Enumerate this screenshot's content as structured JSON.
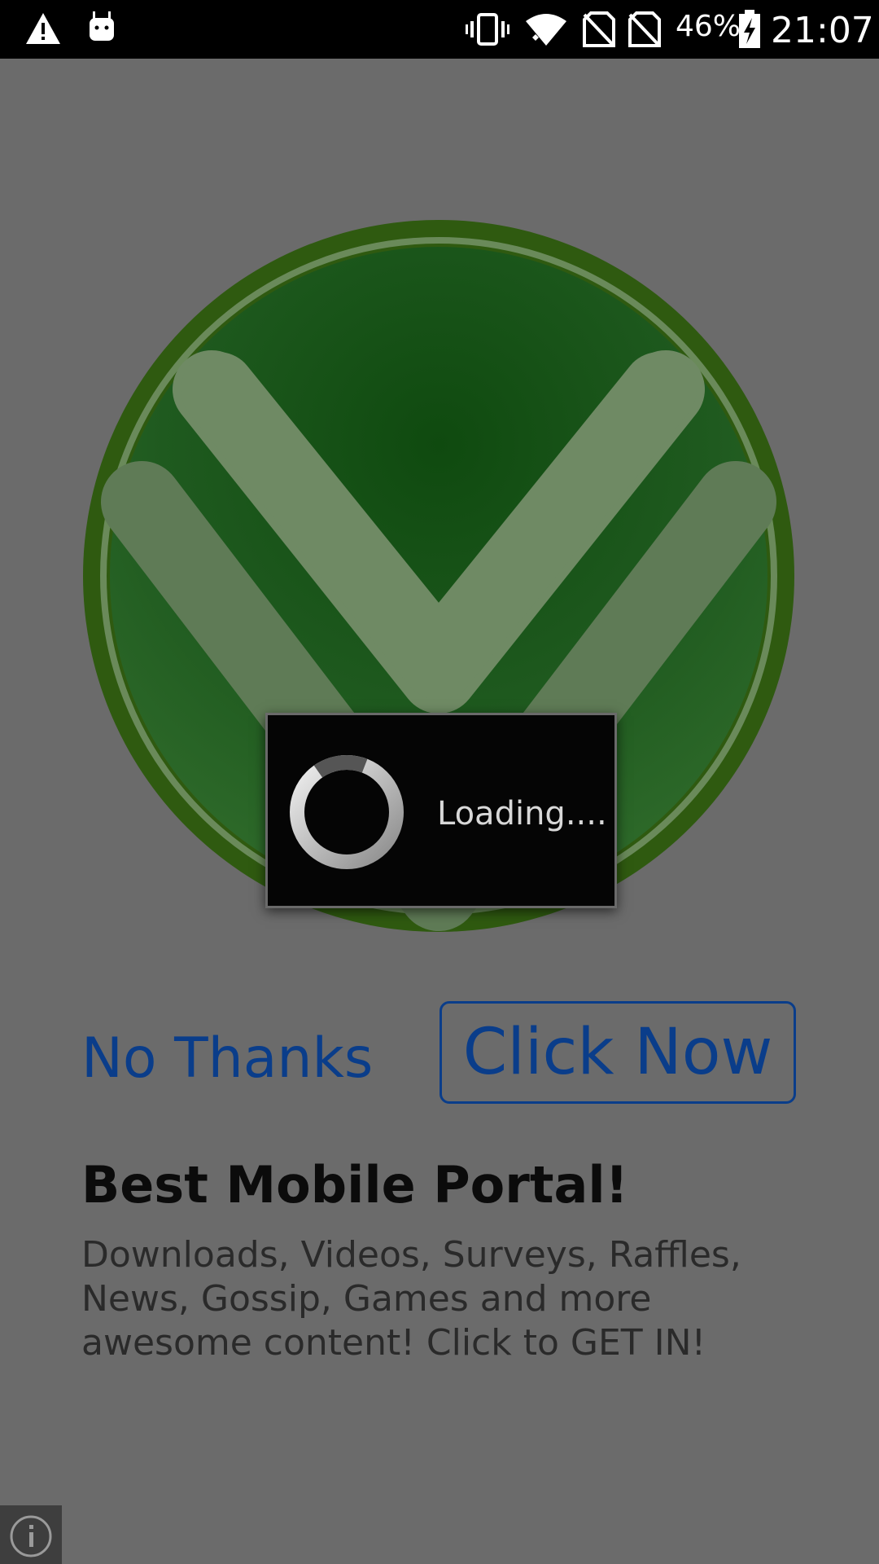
{
  "status_bar": {
    "battery_percent": "46%",
    "time": "21:07",
    "icons": [
      "warning-icon",
      "android-debug-icon",
      "vibrate-icon",
      "wifi-icon",
      "no-sim-icon",
      "no-sim-icon",
      "battery-charging-icon"
    ]
  },
  "badge": {
    "icon": "double-chevron-down-icon",
    "color": "#2f6b1e"
  },
  "loading": {
    "label": "Loading...."
  },
  "actions": {
    "no_thanks": "No Thanks",
    "click_now": "Click Now",
    "link_color": "#0a3d8a"
  },
  "content": {
    "headline": "Best Mobile Portal!",
    "description": "Downloads, Videos, Surveys, Raffles, News, Gossip, Games and more awesome content! Click to GET IN!"
  },
  "info": {
    "icon": "info-icon"
  }
}
